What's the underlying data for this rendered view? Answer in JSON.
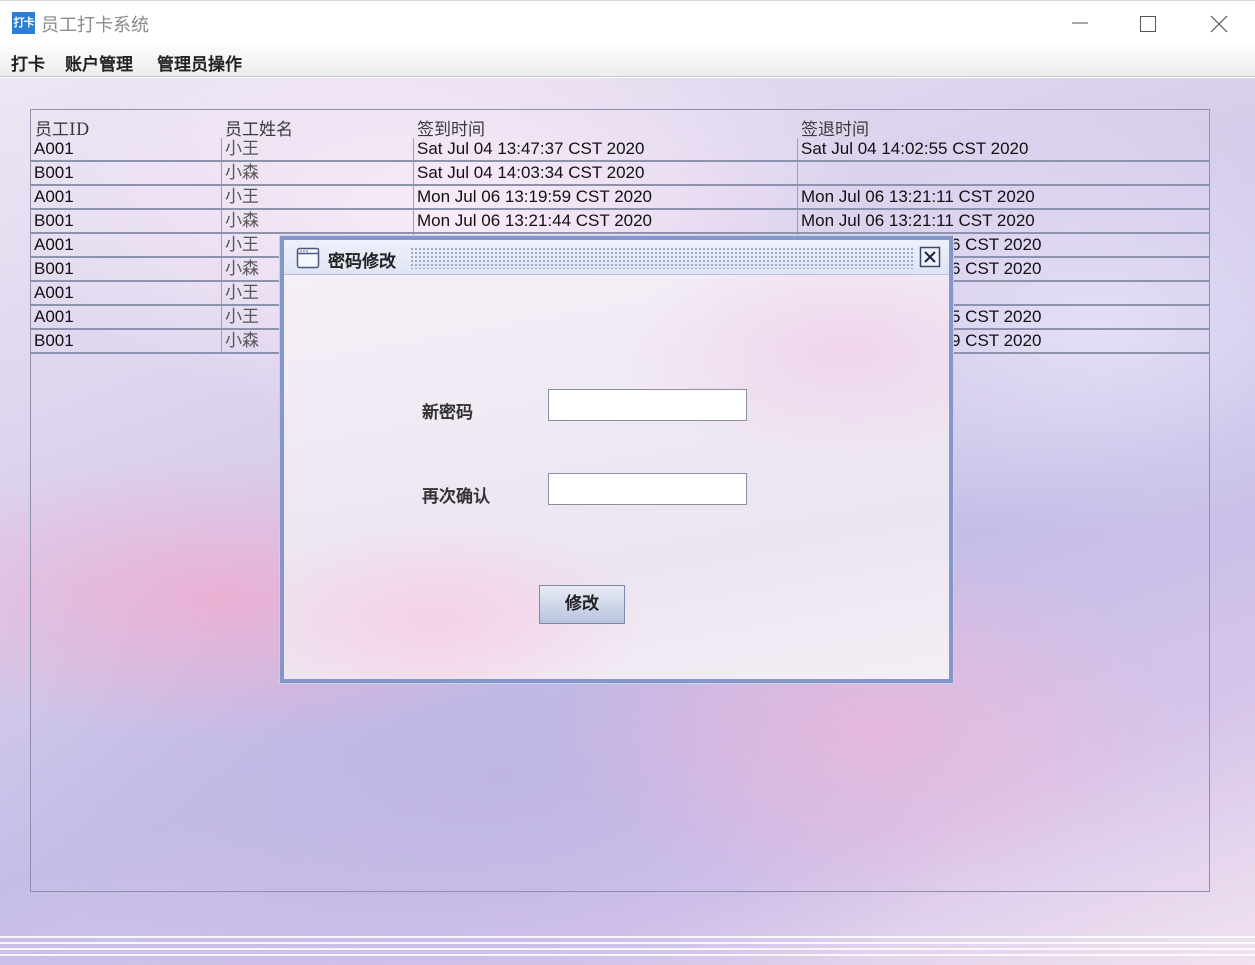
{
  "window": {
    "app_icon_text": "打卡",
    "title": "员工打卡系统"
  },
  "menu": {
    "items": [
      "打卡",
      "账户管理",
      "管理员操作"
    ]
  },
  "table": {
    "headers": [
      "员工ID",
      "员工姓名",
      "签到时间",
      "签退时间"
    ],
    "rows": [
      [
        "A001",
        "小王",
        "Sat Jul 04 13:47:37 CST 2020",
        "Sat Jul 04 14:02:55 CST 2020"
      ],
      [
        "B001",
        "小森",
        "Sat Jul 04 14:03:34 CST 2020",
        ""
      ],
      [
        "A001",
        "小王",
        "Mon Jul 06 13:19:59 CST 2020",
        "Mon Jul 06 13:21:11 CST 2020"
      ],
      [
        "B001",
        "小森",
        "Mon Jul 06 13:21:44 CST 2020",
        "Mon Jul 06 13:21:11 CST 2020"
      ],
      [
        "A001",
        "小王",
        "",
        "6 CST 2020"
      ],
      [
        "B001",
        "小森",
        "",
        "6 CST 2020"
      ],
      [
        "A001",
        "小王",
        "",
        ""
      ],
      [
        "A001",
        "小王",
        "",
        "5 CST 2020"
      ],
      [
        "B001",
        "小森",
        "",
        "9 CST 2020"
      ]
    ]
  },
  "dialog": {
    "title": "密码修改",
    "new_password_label": "新密码",
    "confirm_label": "再次确认",
    "new_password_value": "",
    "confirm_value": "",
    "submit_label": "修改"
  }
}
